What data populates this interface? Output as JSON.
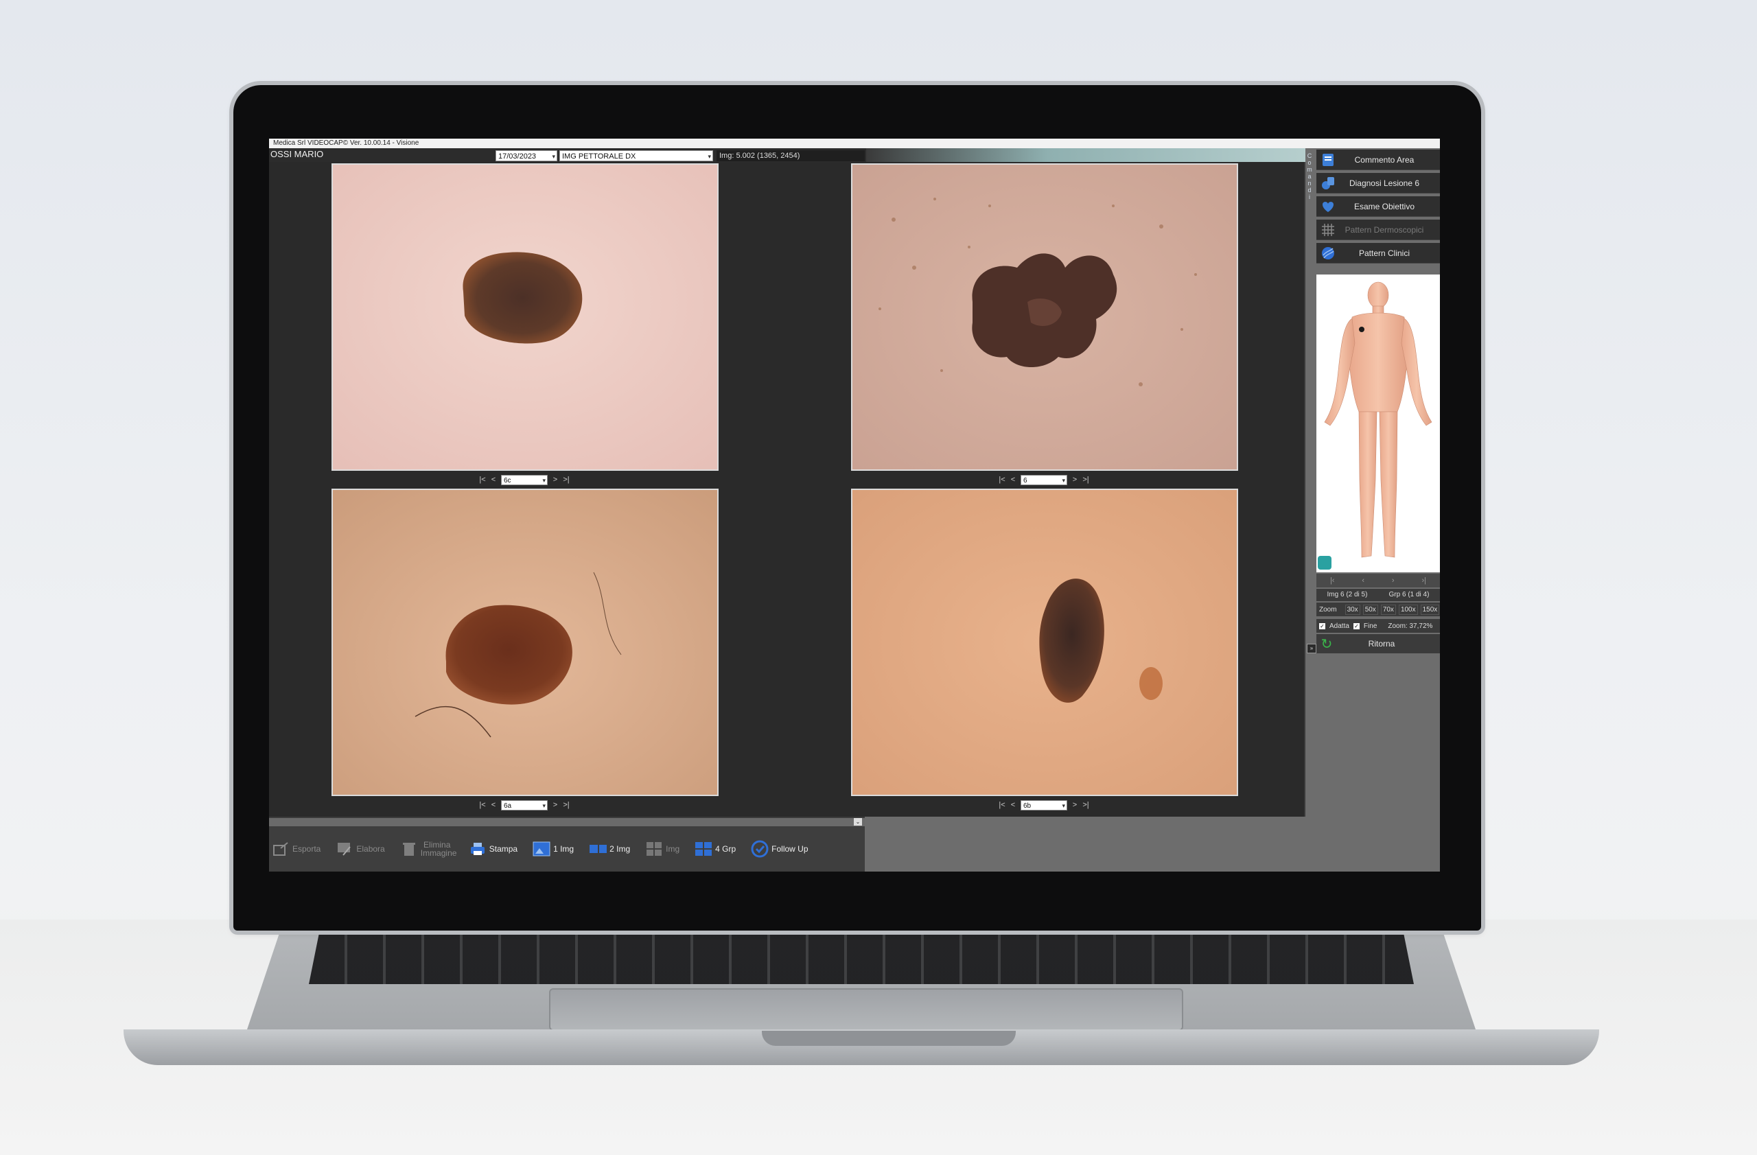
{
  "window": {
    "title": "Medica Srl VIDEOCAP© Ver. 10.00.14 - Visione"
  },
  "header": {
    "patient_name": "OSSI MARIO",
    "date": "17/03/2023",
    "image_group": "IMG PETTORALE DX",
    "image_info": "Img: 5.002 (1365, 2454)"
  },
  "viewer": {
    "panels": [
      {
        "name": "top-left",
        "selected": "6c"
      },
      {
        "name": "top-right",
        "selected": "6"
      },
      {
        "name": "bottom-left",
        "selected": "6a"
      },
      {
        "name": "bottom-right",
        "selected": "6b"
      }
    ],
    "nav": {
      "first": "|<",
      "prev": "<",
      "next": ">",
      "last": ">|"
    }
  },
  "sidebar": {
    "vertical_label": "Comandi",
    "commands": [
      {
        "label": "Commento Area",
        "icon": "comment-icon",
        "enabled": true
      },
      {
        "label": "Diagnosi Lesione 6",
        "icon": "diagnosis-icon",
        "enabled": true
      },
      {
        "label": "Esame Obiettivo",
        "icon": "exam-icon",
        "enabled": true
      },
      {
        "label": "Pattern Dermoscopici",
        "icon": "grid-icon",
        "enabled": false
      },
      {
        "label": "Pattern Clinici",
        "icon": "pattern-icon",
        "enabled": true
      }
    ],
    "img_counter": "Img 6 (2 di 5)",
    "grp_counter": "Grp 6 (1 di 4)",
    "zoom_label": "Zoom",
    "zoom_options": [
      "30x",
      "50x",
      "70x",
      "100x",
      "150x"
    ],
    "adatta_label": "Adatta",
    "fine_label": "Fine",
    "zoom_value": "Zoom: 37,72%",
    "ritorna_label": "Ritorna",
    "expand_label": "»"
  },
  "toolbar": {
    "items": [
      {
        "label": "Esporta",
        "icon": "export-icon",
        "enabled": false
      },
      {
        "label": "Elabora",
        "icon": "process-icon",
        "enabled": false
      },
      {
        "label": "Elimina Immagine",
        "icon": "trash-icon",
        "enabled": false
      },
      {
        "label": "Stampa",
        "icon": "print-icon",
        "enabled": true
      },
      {
        "label": "1 Img",
        "icon": "single-image-icon",
        "enabled": true
      },
      {
        "label": "2 Img",
        "icon": "double-image-icon",
        "enabled": true
      },
      {
        "label": "Img",
        "icon": "multi-image-icon",
        "enabled": false
      },
      {
        "label": "4 Grp",
        "icon": "four-group-icon",
        "enabled": true
      },
      {
        "label": "Follow Up",
        "icon": "follow-up-icon",
        "enabled": true
      }
    ]
  },
  "colors": {
    "accent_blue": "#2f6fd6",
    "panel_bg": "#2a2a2a",
    "sidebar_bg": "#6d6d6d"
  }
}
